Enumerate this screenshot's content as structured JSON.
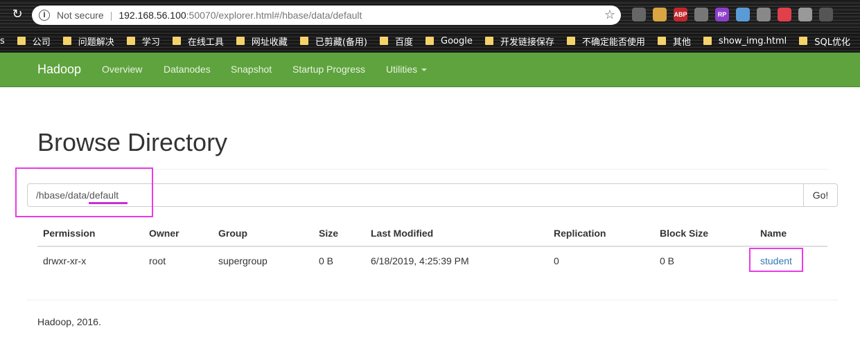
{
  "browser": {
    "security_label": "Not secure",
    "url_host": "192.168.56.100",
    "url_rest": ":50070/explorer.html#/hbase/data/default",
    "extensions": [
      {
        "icon": "ext-doc-icon",
        "color": "#666"
      },
      {
        "icon": "ext-cat-icon",
        "color": "#d9a441"
      },
      {
        "icon": "ext-abp-icon",
        "label": "ABP",
        "color": "#c1272d"
      },
      {
        "icon": "ext-tag-icon",
        "color": "#777"
      },
      {
        "icon": "ext-rp-icon",
        "label": "RP",
        "color": "#8e3fc9"
      },
      {
        "icon": "ext-circle-icon",
        "color": "#5b9bd5"
      },
      {
        "icon": "ext-q-icon",
        "color": "#888"
      },
      {
        "icon": "ext-red-icon",
        "color": "#e0404a"
      },
      {
        "icon": "ext-cloud-icon",
        "color": "#999"
      },
      {
        "icon": "ext-oo-icon",
        "color": "#555"
      }
    ]
  },
  "bookmarks": [
    "s",
    "公司",
    "问题解决",
    "学习",
    "在线工具",
    "网址收藏",
    "已剪藏(备用)",
    "百度",
    "Google",
    "开发链接保存",
    "不确定能否使用",
    "其他",
    "show_img.html",
    "SQL优化"
  ],
  "navbar": {
    "brand": "Hadoop",
    "items": [
      "Overview",
      "Datanodes",
      "Snapshot",
      "Startup Progress",
      "Utilities"
    ]
  },
  "page": {
    "title": "Browse Directory",
    "path_value": "/hbase/data/default",
    "go_label": "Go!"
  },
  "table": {
    "headers": [
      "Permission",
      "Owner",
      "Group",
      "Size",
      "Last Modified",
      "Replication",
      "Block Size",
      "Name"
    ],
    "rows": [
      [
        "drwxr-xr-x",
        "root",
        "supergroup",
        "0 B",
        "6/18/2019, 4:25:39 PM",
        "0",
        "0 B",
        "student"
      ]
    ]
  },
  "footer": "Hadoop, 2016.",
  "colors": {
    "navbar": "#5fa33e",
    "highlight": "#e83be8",
    "link": "#337ab7"
  }
}
